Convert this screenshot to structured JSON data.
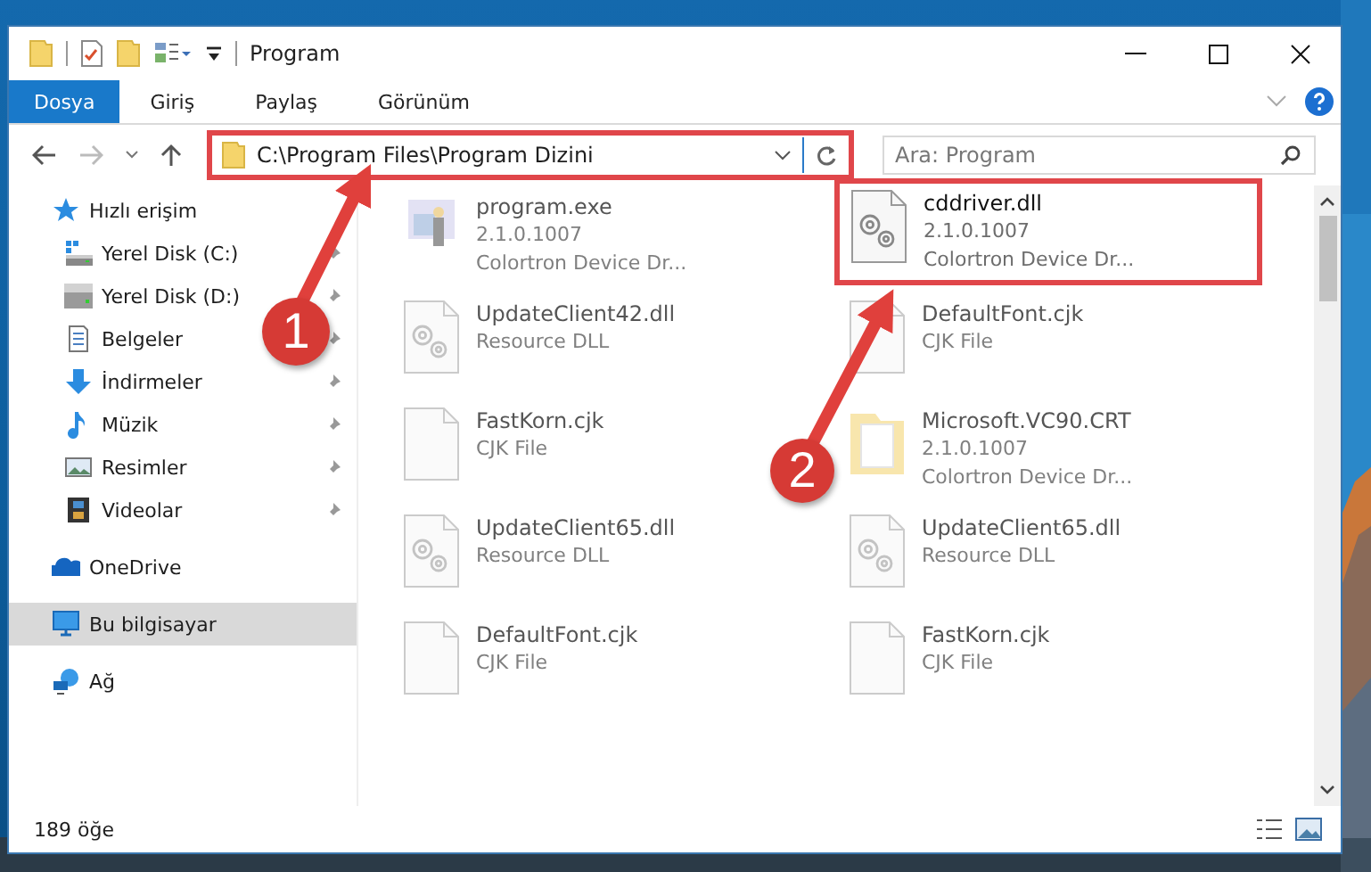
{
  "window": {
    "title": "Program"
  },
  "ribbon_tabs": [
    {
      "label": "Dosya",
      "selected": true
    },
    {
      "label": "Giriş",
      "selected": false
    },
    {
      "label": "Paylaş",
      "selected": false
    },
    {
      "label": "Görünüm",
      "selected": false
    }
  ],
  "address": {
    "value": "C:\\Program Files\\Program Dizini",
    "highlighted": true
  },
  "search": {
    "placeholder": "Ara: Program"
  },
  "sidebar": {
    "items": [
      {
        "label": "Hızlı erişim",
        "selected": false,
        "children": [
          {
            "label": "Yerel Disk (C:)",
            "pinned": true,
            "selected": false
          },
          {
            "label": "Yerel Disk (D:)",
            "pinned": true,
            "selected": false
          },
          {
            "label": "Belgeler",
            "pinned": true,
            "selected": false
          },
          {
            "label": "İndirmeler",
            "pinned": true,
            "selected": false
          },
          {
            "label": "Müzik",
            "pinned": true,
            "selected": false
          },
          {
            "label": "Resimler",
            "pinned": true,
            "selected": false
          },
          {
            "label": "Videolar",
            "pinned": true,
            "selected": false
          }
        ]
      },
      {
        "label": "OneDrive",
        "selected": false
      },
      {
        "label": "Bu bilgisayar",
        "selected": true
      },
      {
        "label": "Ağ",
        "selected": false
      }
    ]
  },
  "files": [
    {
      "name": "program.exe",
      "details": [
        "2.1.0.1007",
        "Colortron Device Dr..."
      ],
      "kind": "app",
      "blurred": true,
      "highlighted": false
    },
    {
      "name": "cddriver.dll",
      "details": [
        "2.1.0.1007",
        "Colortron Device Dr..."
      ],
      "kind": "dll",
      "blurred": false,
      "highlighted": true
    },
    {
      "name": "UpdateClient42.dll",
      "details": [
        "Resource DLL"
      ],
      "kind": "dll",
      "blurred": true,
      "highlighted": false
    },
    {
      "name": "DefaultFont.cjk",
      "details": [
        "CJK File"
      ],
      "kind": "file",
      "blurred": true,
      "highlighted": false
    },
    {
      "name": "FastKorn.cjk",
      "details": [
        "CJK File"
      ],
      "kind": "file",
      "blurred": true,
      "highlighted": false
    },
    {
      "name": "Microsoft.VC90.CRT",
      "details": [
        "2.1.0.1007",
        "Colortron Device Dr..."
      ],
      "kind": "folder",
      "blurred": true,
      "highlighted": false
    },
    {
      "name": "UpdateClient65.dll",
      "details": [
        "Resource DLL"
      ],
      "kind": "dll",
      "blurred": true,
      "highlighted": false
    },
    {
      "name": "UpdateClient65.dll",
      "details": [
        "Resource DLL"
      ],
      "kind": "dll",
      "blurred": true,
      "highlighted": false
    },
    {
      "name": "DefaultFont.cjk",
      "details": [
        "CJK File"
      ],
      "kind": "file",
      "blurred": true,
      "highlighted": false
    },
    {
      "name": "FastKorn.cjk",
      "details": [
        "CJK File"
      ],
      "kind": "file",
      "blurred": true,
      "highlighted": false
    }
  ],
  "status_bar": {
    "count": "189 öğe"
  },
  "annotations": [
    {
      "label": "1"
    },
    {
      "label": "2"
    }
  ]
}
